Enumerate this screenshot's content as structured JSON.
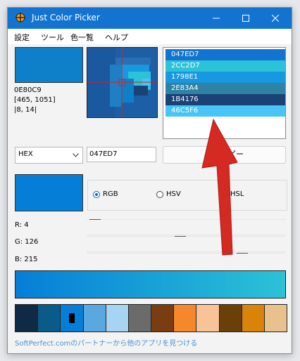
{
  "window": {
    "title": "Just Color Picker"
  },
  "menu": [
    "設定",
    "ツール",
    "色一覧",
    "ヘルプ"
  ],
  "current": {
    "hex": "0E80C9",
    "coords": "[465, 1051]",
    "offset": "|8, 14|",
    "color": "#0e80c9"
  },
  "list_colors": [
    {
      "hex": "047ED7",
      "color": "#047ed7"
    },
    {
      "hex": "2CC2D7",
      "color": "#2cc2d7"
    },
    {
      "hex": "1798E1",
      "color": "#1798e1"
    },
    {
      "hex": "2E83A4",
      "color": "#2e83a4"
    },
    {
      "hex": "1B4176",
      "color": "#1b4176"
    },
    {
      "hex": "46C5F6",
      "color": "#46c5f6"
    }
  ],
  "format": {
    "selected": "HEX"
  },
  "hex_value": "047ED7",
  "copy_button": "値をコピー",
  "selected_color": "#047ed7",
  "color_model": {
    "options": [
      "RGB",
      "HSV",
      "HSL"
    ],
    "selected": "RGB"
  },
  "channels": [
    {
      "label": "R: 4",
      "value": 4,
      "max": 255
    },
    {
      "label": "G: 126",
      "value": 126,
      "max": 255
    },
    {
      "label": "B: 215",
      "value": 215,
      "max": 255
    }
  ],
  "gradient": {
    "from": "#047ed7",
    "to": "#2cc2d7"
  },
  "palette": [
    "#0f2a45",
    "#0a5a8a",
    "#047ed7",
    "#5aa8e0",
    "#a7d4f2",
    "#6b6b6b",
    "#7a3d12",
    "#f5882a",
    "#f9c39a",
    "#6a3f08",
    "#d98408",
    "#e9c18c"
  ],
  "palette_marker_index": 2,
  "promo_link": "SoftPerfect.comのパートナーから他のアプリを見つける",
  "accent": {
    "titlebar": "#1274d0",
    "arrow": "#d42a22"
  }
}
